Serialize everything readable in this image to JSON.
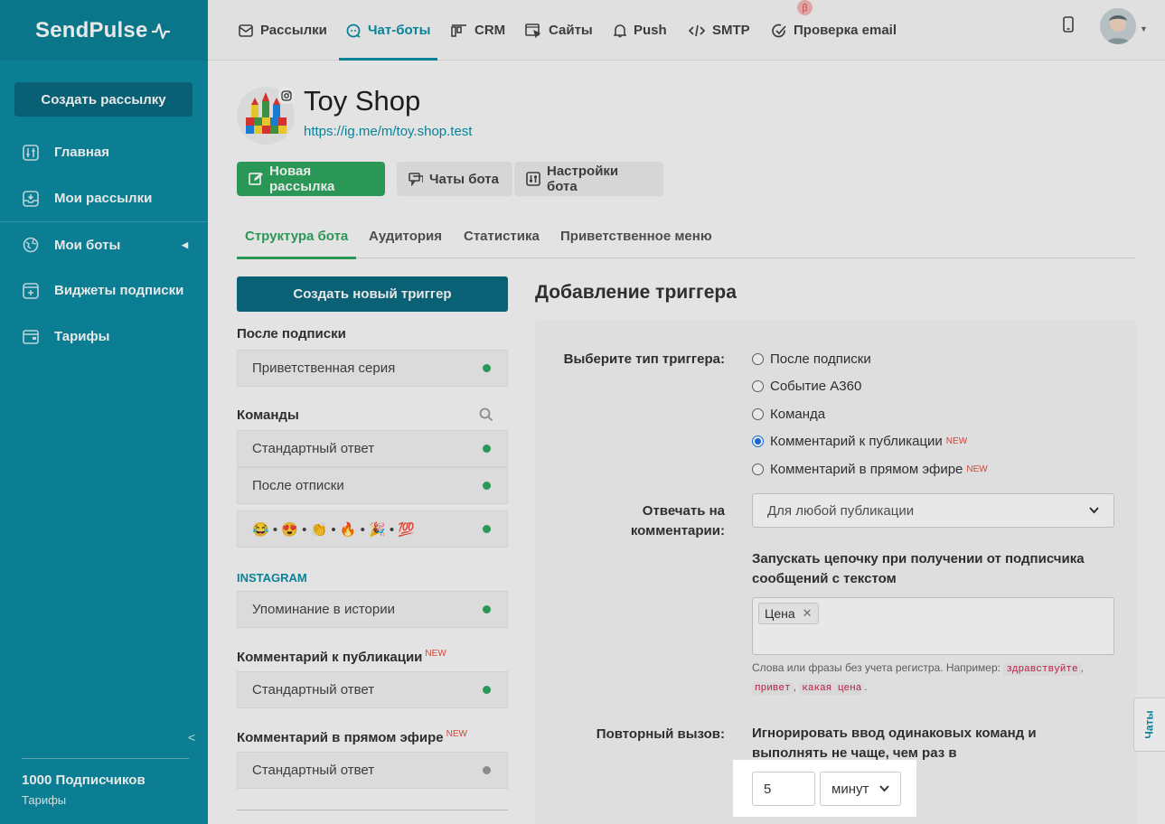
{
  "brand": {
    "logo": "SendPulse"
  },
  "sidebar": {
    "create_button": "Создать рассылку",
    "items": [
      {
        "label": "Главная",
        "icon": "sliders-icon"
      },
      {
        "label": "Мои рассылки",
        "icon": "inbox-icon"
      },
      {
        "label": "Мои боты",
        "icon": "globe-icon"
      },
      {
        "label": "Виджеты подписки",
        "icon": "widget-icon"
      },
      {
        "label": "Тарифы",
        "icon": "wallet-icon"
      }
    ],
    "footer_count": "1000 Подписчиков",
    "footer_link": "Тарифы"
  },
  "topnav": {
    "items": [
      {
        "label": "Рассылки",
        "icon": "mail-icon"
      },
      {
        "label": "Чат-боты",
        "icon": "chat-icon",
        "active": true
      },
      {
        "label": "CRM",
        "icon": "crm-icon"
      },
      {
        "label": "Сайты",
        "icon": "site-icon"
      },
      {
        "label": "Push",
        "icon": "bell-icon"
      },
      {
        "label": "SMTP",
        "icon": "code-icon"
      },
      {
        "label": "Проверка email",
        "icon": "check-icon"
      }
    ],
    "beta": "β"
  },
  "bot": {
    "name": "Toy Shop",
    "link": "https://ig.me/m/toy.shop.test"
  },
  "actions": {
    "new_mailing": "Новая рассылка",
    "bot_chats": "Чаты бота",
    "bot_settings": "Настройки бота"
  },
  "tabs": [
    "Структура бота",
    "Аудитория",
    "Статистика",
    "Приветственное меню"
  ],
  "triggers": {
    "create_button": "Создать новый триггер",
    "after_subscribe_title": "После подписки",
    "welcome_series": "Приветственная серия",
    "commands_title": "Команды",
    "standard_reply": "Стандартный ответ",
    "after_unsubscribe": "После отписки",
    "emoji_row": "😂 • 😍 • 👏 • 🔥 • 🎉 • 💯",
    "instagram_title": "INSTAGRAM",
    "story_mention": "Упоминание в истории",
    "post_comment_title": "Комментарий к публикации",
    "live_comment_title": "Комментарий в прямом эфире",
    "new_badge": "NEW"
  },
  "form": {
    "title": "Добавление триггера",
    "type_label": "Выберите тип триггера:",
    "options": [
      "После подписки",
      "Событие А360",
      "Команда",
      "Комментарий к публикации",
      "Комментарий в прямом эфире"
    ],
    "selected_option": 3,
    "reply_label_1": "Отвечать на",
    "reply_label_2": "комментарии:",
    "reply_select": "Для любой публикации",
    "chain_text": "Запускать цепочку при получении от подписчика сообщений с текстом",
    "tag": "Цена",
    "hint_prefix": "Слова или фразы без учета регистра. Например:",
    "hint_words": [
      "здравствуйте",
      "привет",
      "какая цена"
    ],
    "repeat_label": "Повторный вызов:",
    "repeat_text": "Игнорировать ввод одинаковых команд и выполнять не чаще, чем раз в",
    "repeat_value": "5",
    "repeat_unit": "минут"
  },
  "chats_tab": "Чаты"
}
